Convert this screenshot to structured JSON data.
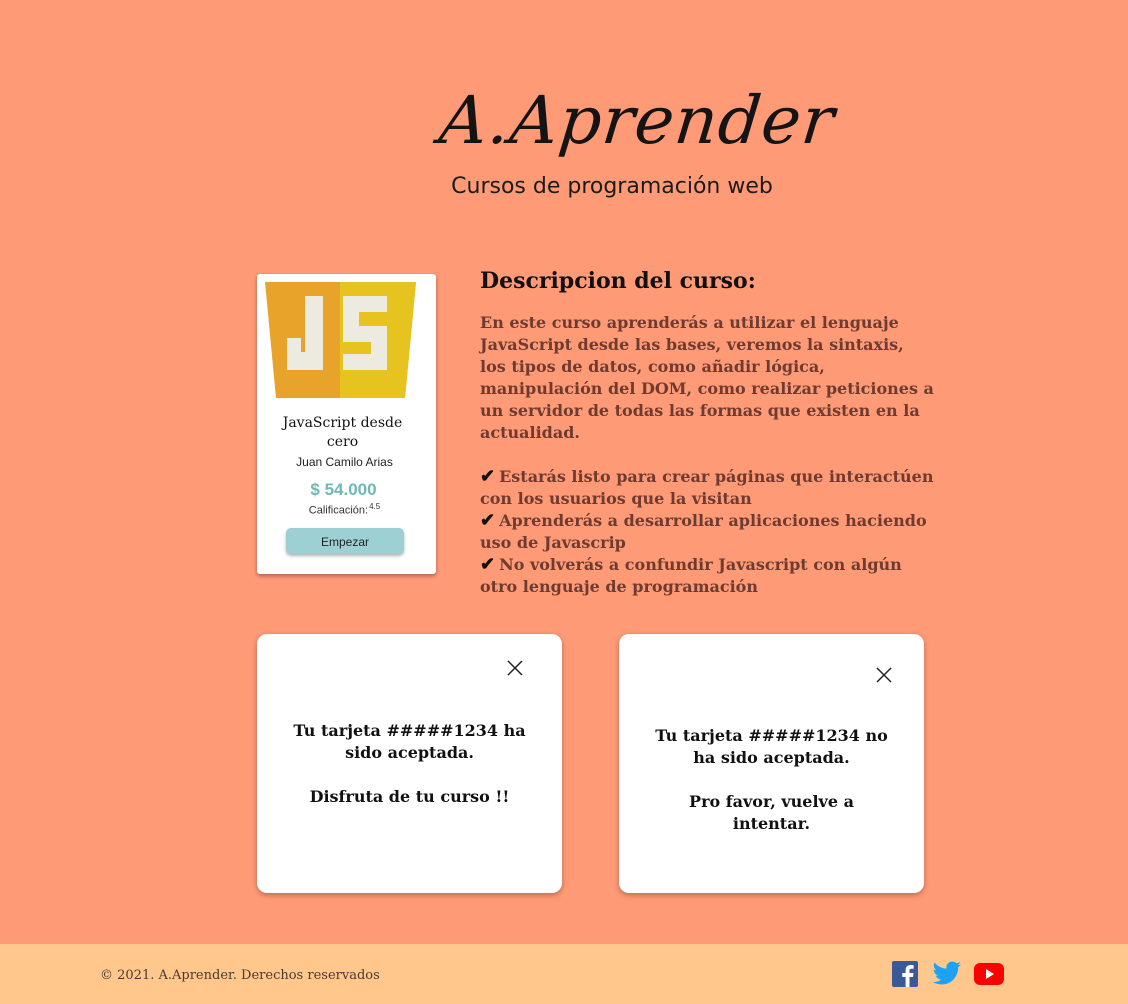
{
  "header": {
    "logo_text": "A.Aprender",
    "tagline": "Cursos de programación web"
  },
  "course_card": {
    "thumbnail_icon": "javascript-logo",
    "title": "JavaScript desde cero",
    "author": "Juan Camilo Arias",
    "price": "$ 54.000",
    "rating_label": "Calificación:",
    "rating_value": "4.5",
    "start_button_label": "Empezar"
  },
  "description": {
    "heading": "Descripcion del curso:",
    "body": "En este curso aprenderás a utilizar el lenguaje JavaScript desde las bases, veremos la sintaxis, los tipos de datos, como añadir lógica, manipulación del DOM, como realizar peticiones a un servidor de todas las formas que existen en la actualidad.",
    "check_symbol": "✔",
    "bullets": [
      "Estarás listo para crear páginas que interactúen con los usuarios que la visitan",
      "Aprenderás a desarrollar aplicaciones haciendo uso de Javascrip",
      "No volverás a confundir Javascript con algún otro lenguaje de programación"
    ]
  },
  "modals": {
    "success": {
      "message": "Tu tarjeta #####1234 ha sido aceptada.",
      "sub_message": "Disfruta de tu curso !!"
    },
    "error": {
      "message": "Tu tarjeta #####1234 no ha sido aceptada.",
      "sub_message": "Pro favor, vuelve a intentar."
    }
  },
  "footer": {
    "copyright": "© 2021. A.Aprender. Derechos reservados",
    "social_icons": [
      "facebook-icon",
      "twitter-icon",
      "youtube-icon"
    ]
  },
  "colors": {
    "background": "#FF9A76",
    "footer": "#FFC78C",
    "price": "#6FB8B6",
    "button": "#9DD0D3",
    "description_text": "#6E3B31",
    "facebook": "#3B5998",
    "twitter": "#1DA1F2",
    "youtube": "#FF0000",
    "js_orange": "#E8A32B",
    "js_yellow": "#E6C31E"
  }
}
